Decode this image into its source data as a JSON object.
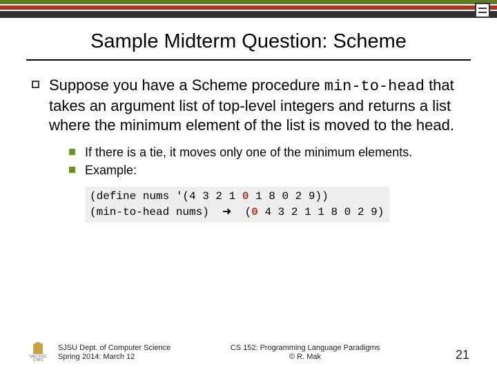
{
  "title": "Sample Midterm Question: Scheme",
  "lvl1": {
    "pre": "Suppose you have a Scheme procedure ",
    "code": "min-to-head",
    "post": " that takes an argument list of top-level integers and returns a list where the minimum element of the list is moved to the head."
  },
  "lvl2": {
    "a": "If there is a tie, it moves only one of the minimum elements.",
    "b": "Example:"
  },
  "code": {
    "line1a": "(define nums '(4 3 2 1 ",
    "line1z": "0",
    "line1b": " 1 8 0 2 9))",
    "line2a": "(min-to-head nums)  ",
    "arrow": "➜",
    "line2b": "  (",
    "line2z": "0",
    "line2c": " 4 3 2 1 1 8 0 2 9)"
  },
  "footer": {
    "left1": "SJSU Dept. of Computer Science",
    "left2": "Spring 2014: March 12",
    "center1": "CS 152: Programming Language Paradigms",
    "center2": "© R. Mak",
    "page": "21",
    "logo_text": "SAN JOSE STATE"
  }
}
